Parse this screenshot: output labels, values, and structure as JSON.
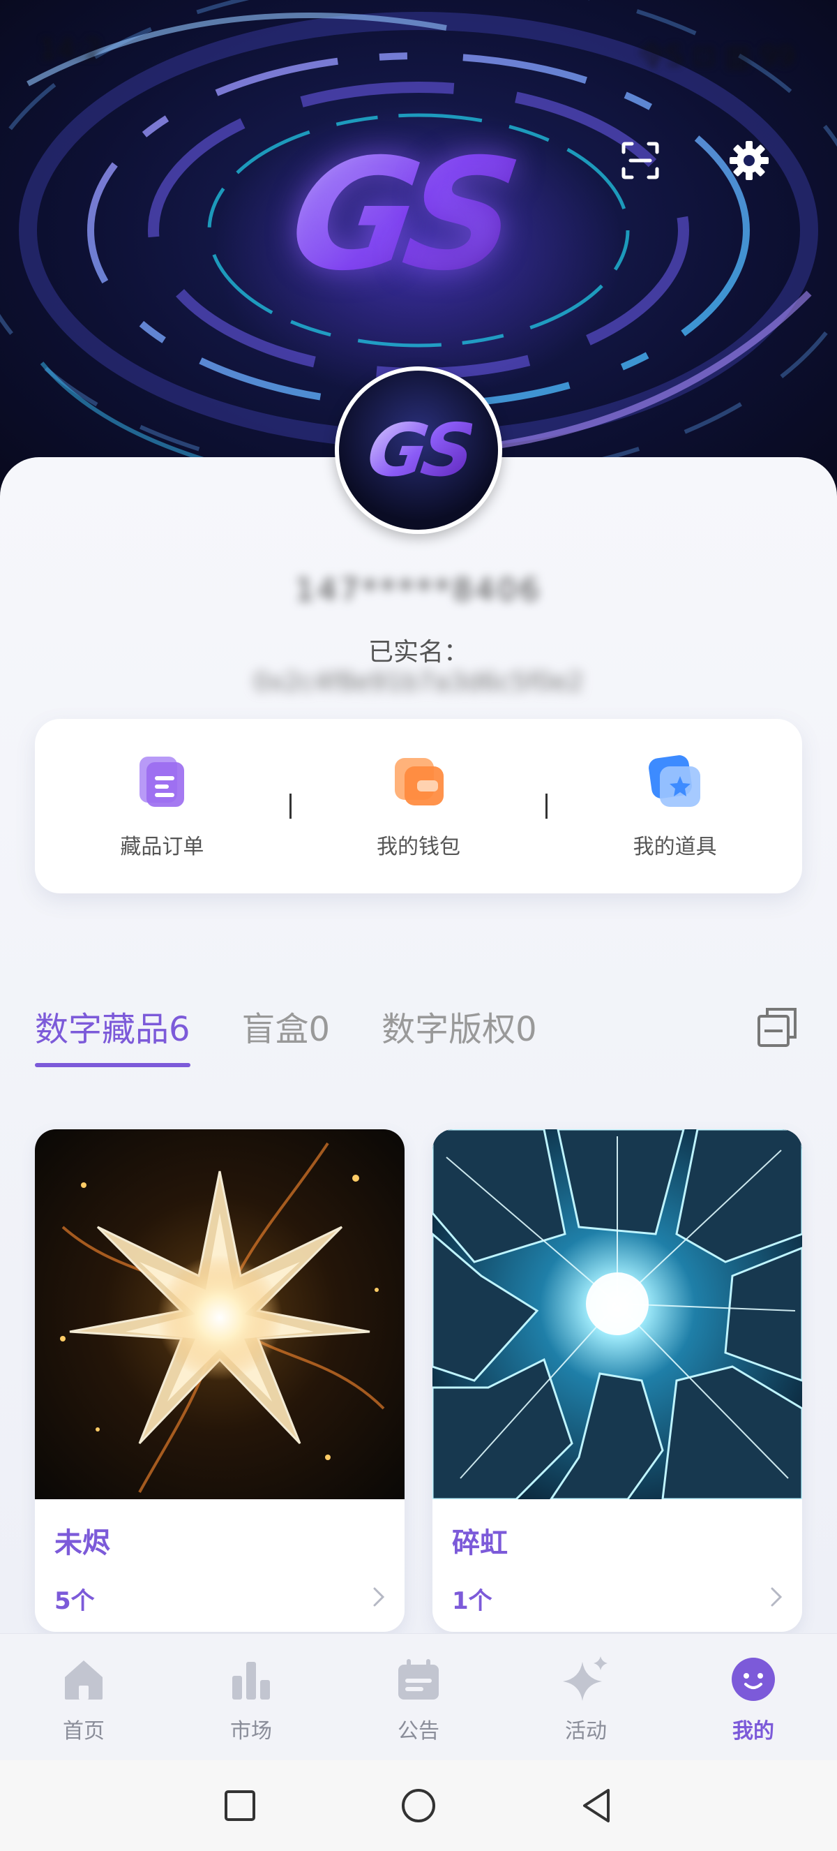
{
  "status_bar": {
    "time": "14:2",
    "right": "令S ⊡ ▥ 99"
  },
  "header": {
    "logo_text": "GS",
    "scan_icon": "scan-icon",
    "settings_icon": "gear-icon"
  },
  "profile": {
    "avatar_text": "GS",
    "username": "147*****8406",
    "realname_label": "已实名：",
    "realname_value": "0x2c4f8e91b7a3d6c5f0e2"
  },
  "quick_actions": [
    {
      "label": "藏品订单",
      "icon": "order-document-icon",
      "color": "#9b6cf0"
    },
    {
      "label": "我的钱包",
      "icon": "wallet-icon",
      "color": "#ff8a3d"
    },
    {
      "label": "我的道具",
      "icon": "props-star-icon",
      "color": "#3d8bff"
    }
  ],
  "tabs": [
    {
      "label": "数字藏品6",
      "active": true
    },
    {
      "label": "盲盒0",
      "active": false
    },
    {
      "label": "数字版权0",
      "active": false
    }
  ],
  "collections": [
    {
      "name": "未烬",
      "count": "5个"
    },
    {
      "name": "碎虹",
      "count": "1个"
    }
  ],
  "bottom_nav": [
    {
      "label": "首页",
      "icon": "home-icon",
      "active": false
    },
    {
      "label": "市场",
      "icon": "market-chart-icon",
      "active": false
    },
    {
      "label": "公告",
      "icon": "announcement-icon",
      "active": false
    },
    {
      "label": "活动",
      "icon": "sparkle-icon",
      "active": false
    },
    {
      "label": "我的",
      "icon": "profile-smile-icon",
      "active": true
    }
  ],
  "colors": {
    "accent": "#7c5ad9",
    "inactive": "#8a8d99",
    "background": "#eef0f7"
  }
}
